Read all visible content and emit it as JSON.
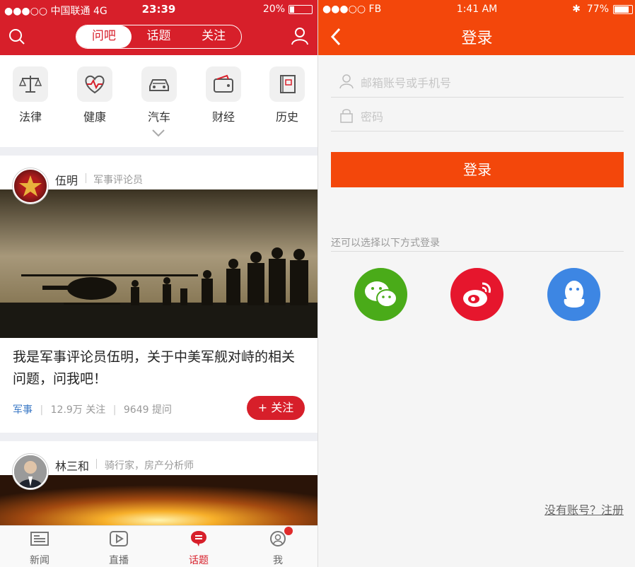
{
  "left": {
    "status": {
      "carrier": "●●●○○ 中国联通  4G",
      "time": "23:39",
      "battery": "20%"
    },
    "header": {
      "tabs": [
        "问吧",
        "话题",
        "关注"
      ],
      "active_tab": "问吧"
    },
    "categories": [
      {
        "label": "法律",
        "icon": "scale-icon"
      },
      {
        "label": "健康",
        "icon": "heart-pulse-icon"
      },
      {
        "label": "汽车",
        "icon": "car-icon"
      },
      {
        "label": "财经",
        "icon": "wallet-icon"
      },
      {
        "label": "历史",
        "icon": "book-icon"
      }
    ],
    "cards": [
      {
        "name": "伍明",
        "role": "军事评论员",
        "title": "我是军事评论员伍明，关于中美军舰对峙的相关问题，问我吧！",
        "tag": "军事",
        "followers": "12.9万 关注",
        "questions": "9649 提问",
        "follow_label": "+ 关注"
      },
      {
        "name": "林三和",
        "role": "骑行家，房产分析师"
      }
    ],
    "tabbar": [
      {
        "label": "新闻",
        "icon": "newspaper-icon"
      },
      {
        "label": "直播",
        "icon": "play-icon"
      },
      {
        "label": "话题",
        "icon": "chat-bubble-icon",
        "active": true
      },
      {
        "label": "我",
        "icon": "user-icon"
      }
    ]
  },
  "right": {
    "status": {
      "carrier": "●●●○○ FB",
      "time": "1:41 AM",
      "battery": "77%"
    },
    "title": "登录",
    "username_placeholder": "邮箱账号或手机号",
    "password_placeholder": "密码",
    "login_button": "登录",
    "alt_login_label": "还可以选择以下方式登录",
    "social": [
      {
        "name": "wechat",
        "color": "#4aab19"
      },
      {
        "name": "weibo",
        "color": "#e6162d"
      },
      {
        "name": "qq",
        "color": "#3d86e3"
      }
    ],
    "register_link": "没有账号？注册"
  }
}
